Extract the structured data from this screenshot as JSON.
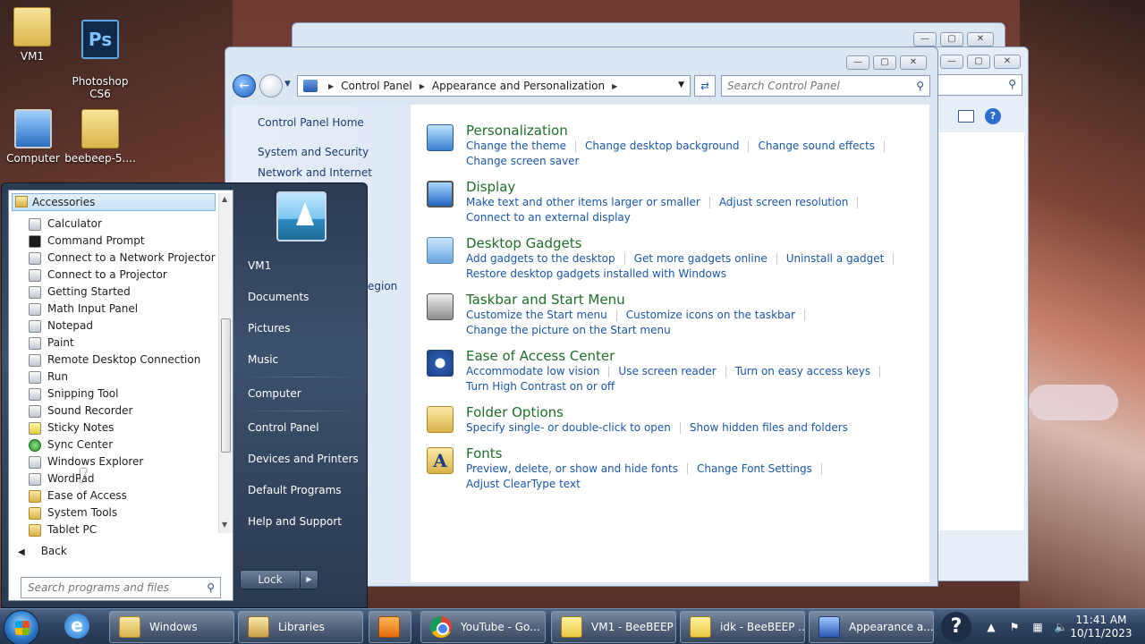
{
  "desktop": {
    "icons": [
      {
        "label": "VM1",
        "icon": "user-folder-icon"
      },
      {
        "label": "Photoshop\nCS6",
        "icon": "photoshop-icon",
        "glyph": "Ps"
      },
      {
        "label": "Computer",
        "icon": "computer-icon"
      },
      {
        "label": "beebeep-5....",
        "icon": "folder-icon"
      }
    ]
  },
  "window": {
    "breadcrumb": [
      "Control Panel",
      "Appearance and Personalization"
    ],
    "search_placeholder": "Search Control Panel",
    "partial_left_text": "egion",
    "left_nav": [
      "Control Panel Home",
      "System and Security",
      "Network and Internet"
    ],
    "categories": [
      {
        "title": "Personalization",
        "icon": "personalization-icon",
        "links": [
          "Change the theme",
          "Change desktop background",
          "Change sound effects",
          "Change screen saver"
        ]
      },
      {
        "title": "Display",
        "icon": "display-icon",
        "links": [
          "Make text and other items larger or smaller",
          "Adjust screen resolution",
          "Connect to an external display"
        ]
      },
      {
        "title": "Desktop Gadgets",
        "icon": "desktop-gadgets-icon",
        "links": [
          "Add gadgets to the desktop",
          "Get more gadgets online",
          "Uninstall a gadget",
          "Restore desktop gadgets installed with Windows"
        ]
      },
      {
        "title": "Taskbar and Start Menu",
        "icon": "taskbar-icon",
        "links": [
          "Customize the Start menu",
          "Customize icons on the taskbar",
          "Change the picture on the Start menu"
        ]
      },
      {
        "title": "Ease of Access Center",
        "icon": "ease-of-access-icon",
        "links": [
          "Accommodate low vision",
          "Use screen reader",
          "Turn on easy access keys",
          "Turn High Contrast on or off"
        ]
      },
      {
        "title": "Folder Options",
        "icon": "folder-options-icon",
        "links": [
          "Specify single- or double-click to open",
          "Show hidden files and folders"
        ]
      },
      {
        "title": "Fonts",
        "icon": "fonts-icon",
        "glyph": "A",
        "links": [
          "Preview, delete, or show and hide fonts",
          "Change Font Settings",
          "Adjust ClearType text"
        ]
      }
    ]
  },
  "start_menu": {
    "folder_header": "Accessories",
    "programs": [
      {
        "label": "Calculator",
        "icon": "calculator-icon"
      },
      {
        "label": "Command Prompt",
        "icon": "command-prompt-icon"
      },
      {
        "label": "Connect to a Network Projector",
        "icon": "network-projector-icon"
      },
      {
        "label": "Connect to a Projector",
        "icon": "projector-icon"
      },
      {
        "label": "Getting Started",
        "icon": "getting-started-icon"
      },
      {
        "label": "Math Input Panel",
        "icon": "math-input-icon"
      },
      {
        "label": "Notepad",
        "icon": "notepad-icon"
      },
      {
        "label": "Paint",
        "icon": "paint-icon"
      },
      {
        "label": "Remote Desktop Connection",
        "icon": "remote-desktop-icon"
      },
      {
        "label": "Run",
        "icon": "run-icon"
      },
      {
        "label": "Snipping Tool",
        "icon": "snipping-tool-icon"
      },
      {
        "label": "Sound Recorder",
        "icon": "sound-recorder-icon"
      },
      {
        "label": "Sticky Notes",
        "icon": "sticky-notes-icon"
      },
      {
        "label": "Sync Center",
        "icon": "sync-center-icon"
      },
      {
        "label": "Windows Explorer",
        "icon": "windows-explorer-icon"
      },
      {
        "label": "WordPad",
        "icon": "wordpad-icon"
      },
      {
        "label": "Ease of Access",
        "icon": "folder-icon"
      },
      {
        "label": "System Tools",
        "icon": "folder-icon"
      },
      {
        "label": "Tablet PC",
        "icon": "folder-icon"
      }
    ],
    "back_label": "Back",
    "search_placeholder": "Search programs and files",
    "right_items": [
      "VM1",
      "Documents",
      "Pictures",
      "Music",
      "Computer",
      "Control Panel",
      "Devices and Printers",
      "Default Programs",
      "Help and Support"
    ],
    "lock_label": "Lock"
  },
  "taskbar": {
    "buttons": [
      {
        "label": "Windows",
        "icon": "folder-icon"
      },
      {
        "label": "Libraries",
        "icon": "libraries-icon"
      },
      {
        "label": "",
        "icon": "media-player-icon"
      },
      {
        "label": "YouTube - Go...",
        "icon": "chrome-icon"
      },
      {
        "label": "VM1 - BeeBEEP",
        "icon": "beebeep-icon"
      },
      {
        "label": "idk - BeeBEEP ...",
        "icon": "beebeep-icon"
      },
      {
        "label": "Appearance a...",
        "icon": "control-panel-icon"
      }
    ],
    "help_glyph": "?",
    "time": "11:41 AM",
    "date": "10/11/2023"
  }
}
